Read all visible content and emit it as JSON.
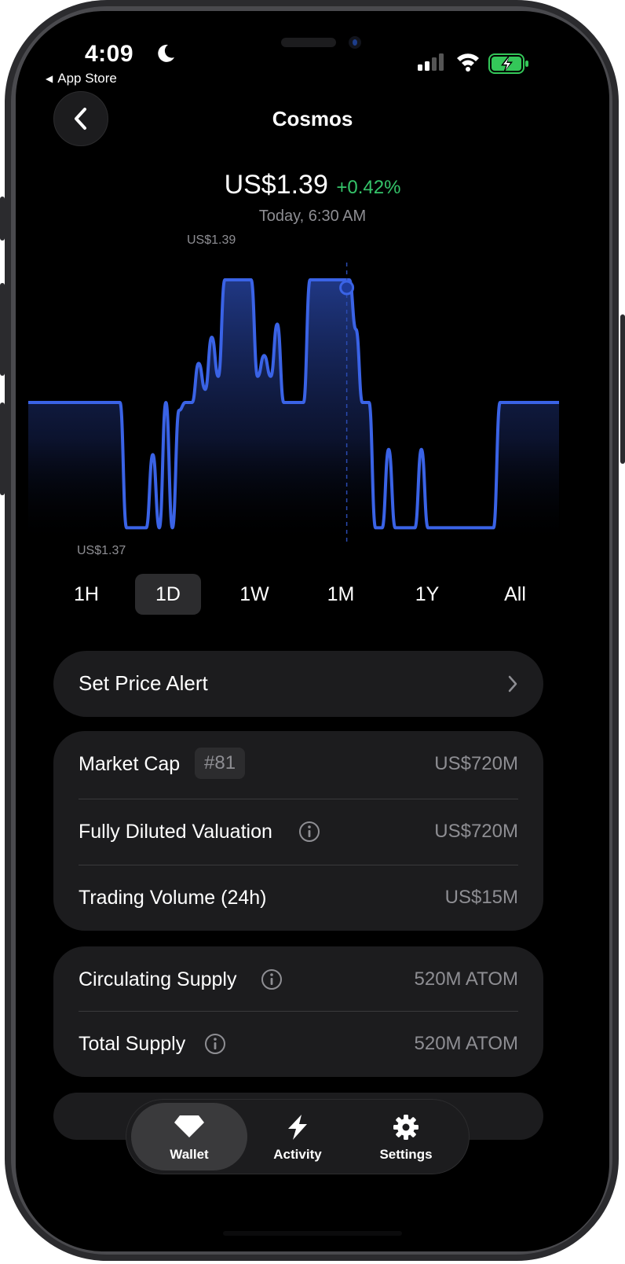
{
  "status_bar": {
    "time": "4:09",
    "back_app": "App Store",
    "icons": [
      "moon-icon",
      "signal-icon",
      "wifi-icon",
      "battery-charging-icon"
    ],
    "battery_color": "#34c759"
  },
  "header": {
    "title": "Cosmos",
    "back_icon": "chevron-left-icon"
  },
  "price": {
    "value": "US$1.39",
    "change": "+0.42%",
    "timestamp": "Today, 6:30 AM",
    "change_color": "#35c46a"
  },
  "chart_data": {
    "type": "area",
    "high_label": "US$1.39",
    "low_label": "US$1.37",
    "line_color": "#3a63e6",
    "relative_levels": [
      0.5,
      0.5,
      0.5,
      0.5,
      0.5,
      0.5,
      0.5,
      0.5,
      0.5,
      0.5,
      0.5,
      0.5,
      0.5,
      0.5,
      0.5,
      0.02,
      0.02,
      0.02,
      0.02,
      0.3,
      0.02,
      0.5,
      0.02,
      0.47,
      0.5,
      0.5,
      0.65,
      0.55,
      0.75,
      0.6,
      0.97,
      0.97,
      0.97,
      0.97,
      0.97,
      0.6,
      0.68,
      0.6,
      0.8,
      0.5,
      0.5,
      0.5,
      0.5,
      0.97,
      0.97,
      0.97,
      0.97,
      0.97,
      0.97,
      0.97,
      0.78,
      0.5,
      0.5,
      0.02,
      0.02,
      0.32,
      0.02,
      0.02,
      0.02,
      0.02,
      0.32,
      0.02,
      0.02,
      0.02,
      0.02,
      0.02,
      0.02,
      0.02,
      0.02,
      0.02,
      0.02,
      0.02,
      0.5,
      0.5,
      0.5,
      0.5,
      0.5,
      0.5,
      0.5,
      0.5,
      0.5,
      0.5
    ],
    "crosshair_fraction": 0.6,
    "y_range_labels": [
      "US$1.37",
      "US$1.39"
    ]
  },
  "range_tabs": {
    "items": [
      "1H",
      "1D",
      "1W",
      "1M",
      "1Y",
      "All"
    ],
    "selected": "1D"
  },
  "alert": {
    "label": "Set Price Alert"
  },
  "market_stats": [
    {
      "label": "Market Cap",
      "badge": "#81",
      "value": "US$720M"
    },
    {
      "label": "Fully Diluted Valuation",
      "value": "US$720M",
      "info": "info-icon"
    },
    {
      "label": "Trading Volume (24h)",
      "value": "US$15M"
    }
  ],
  "supply_stats": [
    {
      "label": "Circulating Supply",
      "value": "520M ATOM",
      "info": "info-icon"
    },
    {
      "label": "Total Supply",
      "value": "520M ATOM",
      "info": "info-icon"
    }
  ],
  "tab_bar": {
    "items": [
      {
        "label": "Wallet",
        "icon": "diamond-icon"
      },
      {
        "label": "Activity",
        "icon": "bolt-icon"
      },
      {
        "label": "Settings",
        "icon": "gear-icon"
      }
    ],
    "selected": "Wallet"
  }
}
